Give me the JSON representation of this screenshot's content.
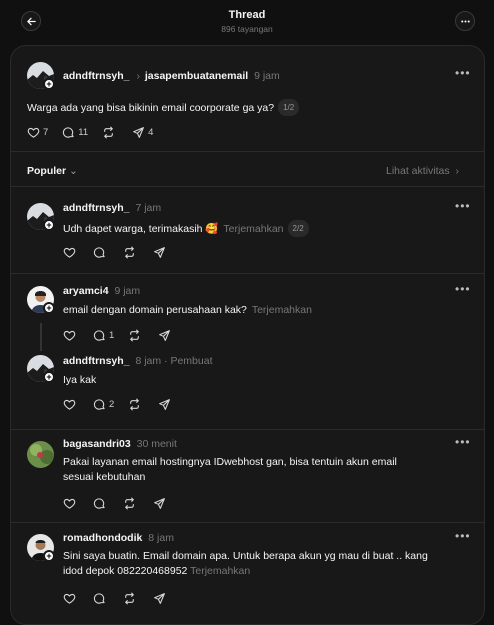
{
  "header": {
    "title": "Thread",
    "views": "896 tayangan"
  },
  "main_post": {
    "author": "adndftrnsyh_",
    "reply_to": "jasapembuatanemail",
    "time": "9 jam",
    "text": "Warga ada yang bisa bikinin email coorporate ga ya?",
    "pager": "1/2",
    "likes": "7",
    "comments": "11",
    "shares": "4"
  },
  "sort": {
    "label": "Populer",
    "activity_link": "Lihat aktivitas"
  },
  "replies": [
    {
      "author": "adndftrnsyh_",
      "time": "7 jam",
      "text": "Udh dapet warga, terimakasih 🥰",
      "translate": "Terjemahkan",
      "pager": "2/2"
    },
    {
      "author": "aryamci4",
      "time": "9 jam",
      "text": "email dengan domain perusahaan kak?",
      "translate": "Terjemahkan",
      "comments": "1"
    },
    {
      "author": "adndftrnsyh_",
      "time": "8 jam",
      "badge": "Pembuat",
      "text": "Iya kak",
      "comments": "2"
    },
    {
      "author": "bagasandri03",
      "time": "30 menit",
      "text_line1": "Pakai layanan email hostingnya IDwebhost gan, bisa tentuin akun email",
      "text_line2": "sesuai kebutuhan"
    },
    {
      "author": "romadhondodik",
      "time": "8 jam",
      "text_line1": "Sini saya buatin. Email domain apa. Untuk berapa akun yg mau di buat .. kang",
      "text_line2": "idod depok 082220468952",
      "translate": "Terjemahkan"
    }
  ],
  "colors": {
    "background": "#101010",
    "card": "#181818",
    "text": "#f3f5f7",
    "muted": "#777777"
  }
}
